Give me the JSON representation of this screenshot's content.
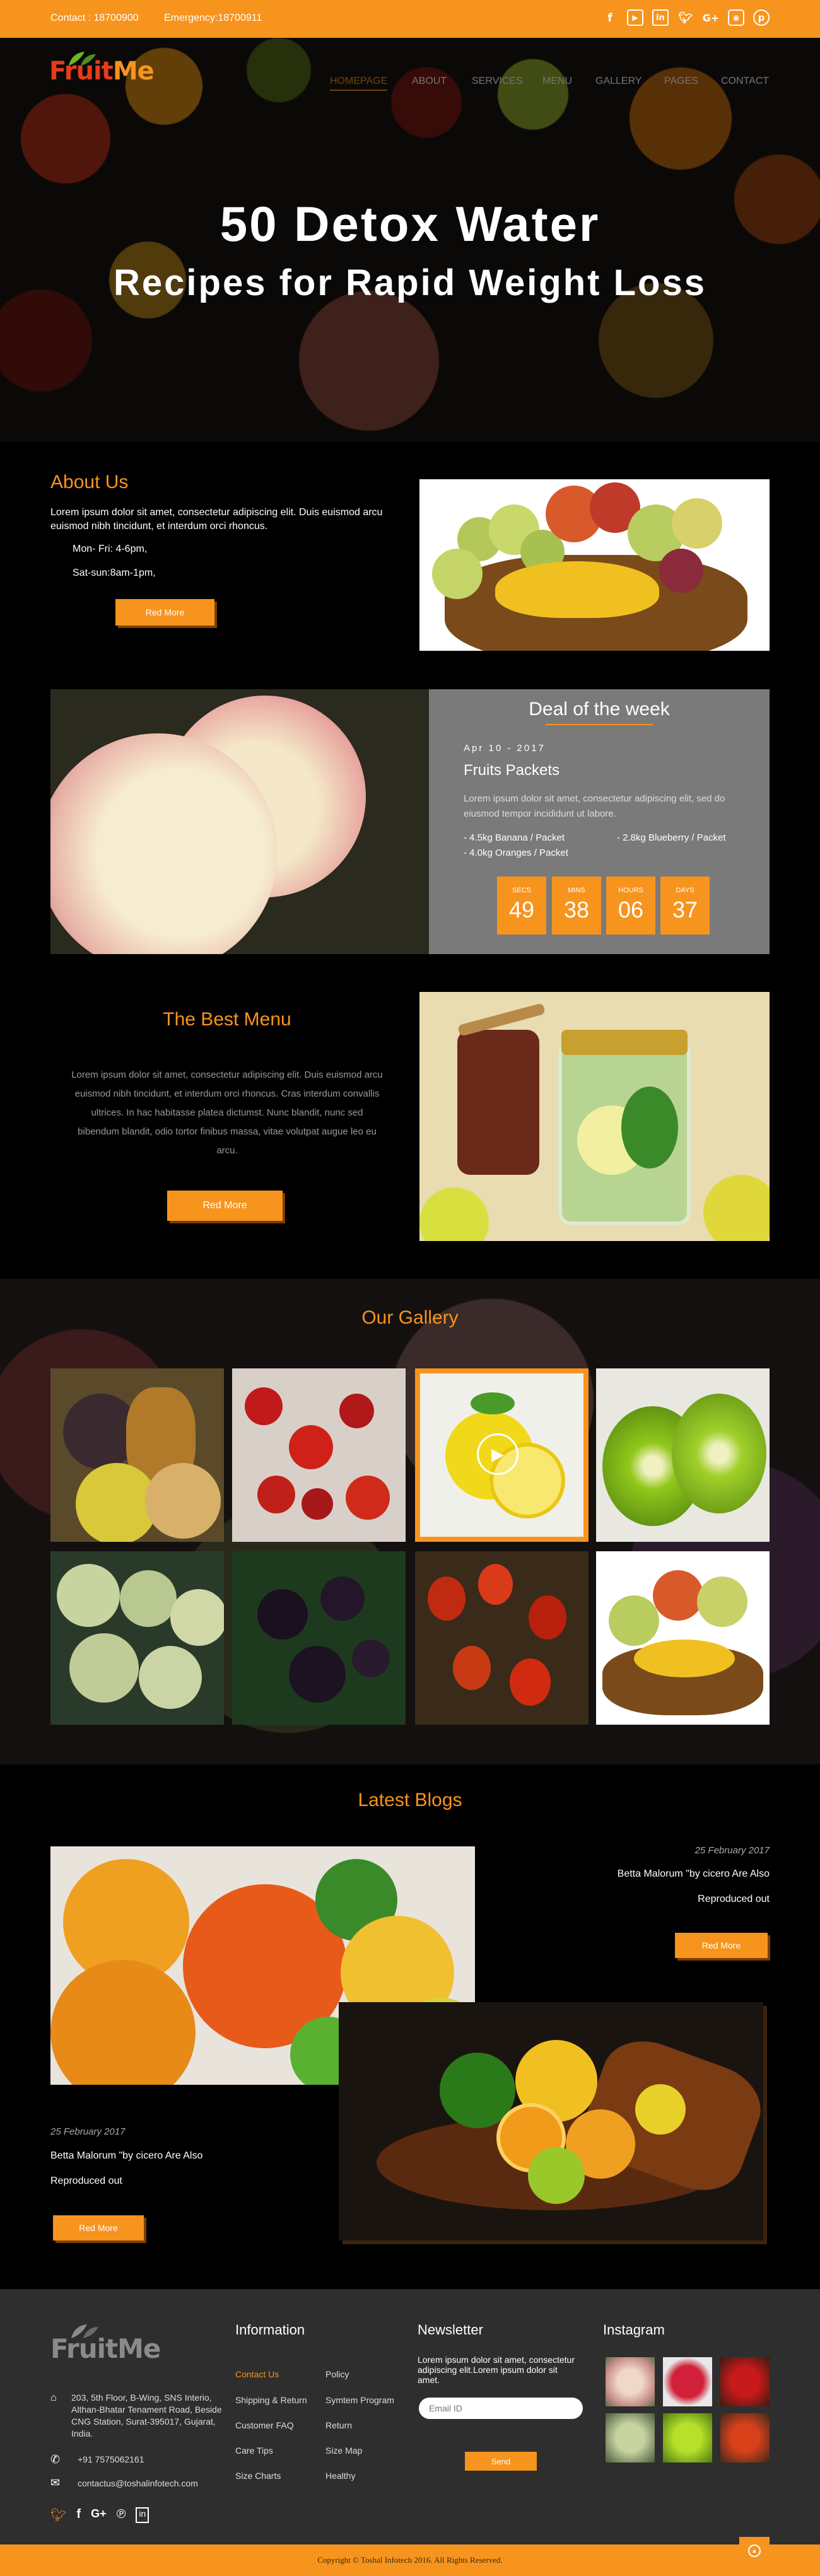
{
  "topbar": {
    "contact": "Contact : 18700900",
    "emergency": "Emergency:18700911",
    "social_icons": [
      "facebook-icon",
      "youtube-icon",
      "linkedin-icon",
      "twitter-icon",
      "google-plus-icon",
      "instagram-icon",
      "pinterest-icon"
    ]
  },
  "brand": {
    "logo_fruit": "Fruit",
    "logo_me": "Me"
  },
  "nav": {
    "items": [
      "HOMEPAGE",
      "ABOUT",
      "SERVICES",
      "MENU",
      "GALLERY",
      "PAGES",
      "CONTACT"
    ],
    "active": "HOMEPAGE"
  },
  "hero": {
    "line1": "50 Detox Water",
    "line2": "Recipes for Rapid Weight Loss"
  },
  "about": {
    "title": "About Us",
    "text": "Lorem ipsum dolor sit amet, consectetur adipiscing elit. Duis euismod arcu euismod nibh tincidunt, et interdum orci rhoncus.",
    "hours1": "Mon- Fri: 4-6pm,",
    "hours2": "Sat-sun:8am-1pm,",
    "button": "Red More"
  },
  "deal": {
    "title": "Deal of the week",
    "date": "Apr 10 - 2017",
    "product": "Fruits Packets",
    "text": "Lorem ipsum dolor sit amet, consectetur adipiscing elit, sed do eiusmod tempor incididunt ut labore.",
    "items": [
      "- 4.5kg Banana / Packet",
      "- 2.8kg Blueberry / Packet",
      "- 4.0kg Oranges / Packet"
    ],
    "countdown": [
      {
        "label": "SECS",
        "value": "49"
      },
      {
        "label": "MINS",
        "value": "38"
      },
      {
        "label": "HOURS",
        "value": "06"
      },
      {
        "label": "DAYS",
        "value": "37"
      }
    ]
  },
  "menu": {
    "title": "The Best Menu",
    "text": "Lorem ipsum dolor sit amet, consectetur adipiscing elit. Duis euismod arcu euismod nibh tincidunt, et interdum orci rhoncus. Cras interdum convallis ultrices. In hac habitasse platea dictumst. Nunc blandit, nunc sed bibendum blandit, odio tortor finibus massa, vitae volutpat augue leo eu arcu.",
    "button": "Red More"
  },
  "gallery": {
    "title": "Our Gallery"
  },
  "blogs": {
    "title": "Latest Blogs",
    "post1": {
      "date": "25 February 2017",
      "line1": "Betta Malorum \"by cicero Are Also",
      "line2": "Reproduced out",
      "button": "Red More"
    },
    "post2": {
      "date": "25 February 2017",
      "line1": "Betta Malorum \"by cicero Are Also",
      "line2": "Reproduced out",
      "button": "Red More"
    }
  },
  "footer": {
    "logo": "FruitMe",
    "address": "203, 5th Floor, B-Wing, SNS Interio, Althan-Bhatar Tenament Road, Beside CNG Station, Surat-395017, Gujarat, India.",
    "phone": "+91 7575062161",
    "email": "contactus@toshalinfotech.com",
    "info_title": "Information",
    "info_col1": [
      "Contact Us",
      "Shipping & Return",
      "Customer FAQ",
      "Care Tips",
      "Size Charts"
    ],
    "info_col2": [
      "Policy",
      "Symtem Program",
      "Return",
      "Size Map",
      "Healthy"
    ],
    "newsletter_title": "Newsletter",
    "newsletter_text": "Lorem ipsum dolor sit amet, consectetur adipiscing elit.Lorem ipsum dolor sit amet.",
    "email_placeholder": "Email ID",
    "send": "Send",
    "instagram_title": "Instagram",
    "copyright": "Copyright © Toshal Infotech 2016. All Rights Reserved."
  },
  "colors": {
    "accent": "#f7941d",
    "deal_bg": "#7a7a7a",
    "footer_bg": "#2e2e2e"
  }
}
